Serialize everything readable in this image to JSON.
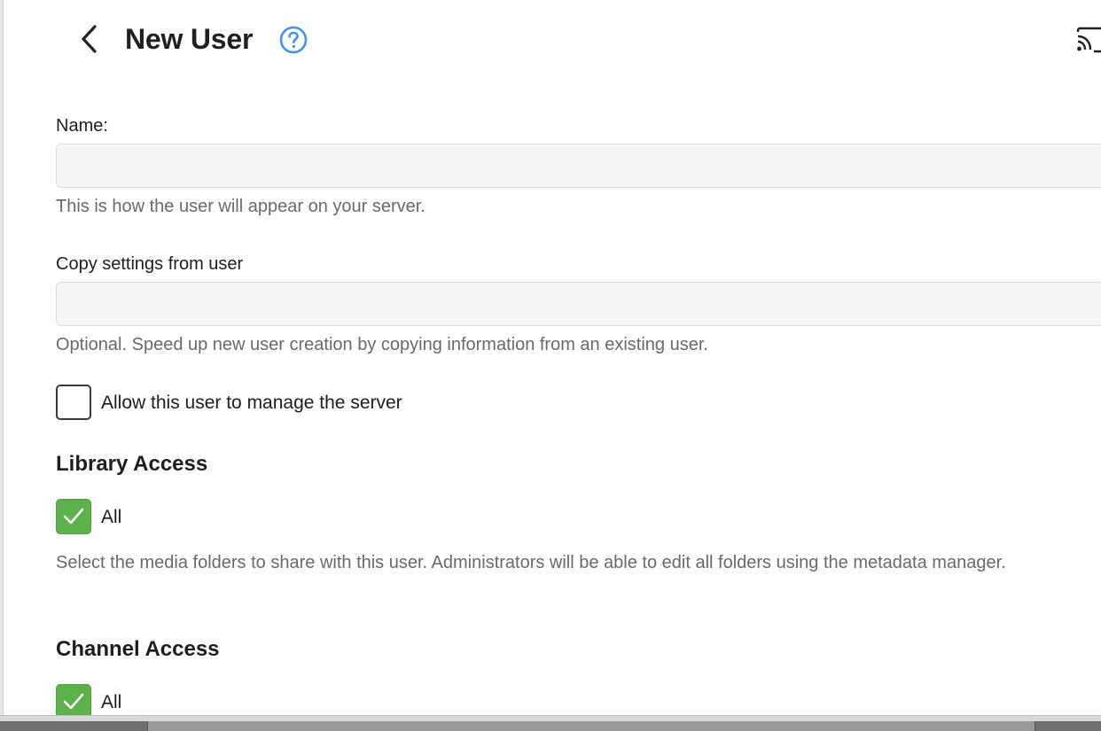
{
  "header": {
    "title": "New User",
    "back_icon": "chevron-left-icon",
    "help_icon": "help-circle-icon",
    "cast_icon": "cast-icon"
  },
  "form": {
    "name": {
      "label": "Name:",
      "value": "",
      "placeholder": "",
      "description": "This is how the user will appear on your server."
    },
    "copy_settings": {
      "label": "Copy settings from user",
      "value": "",
      "placeholder": "",
      "description": "Optional. Speed up new user creation by copying information from an existing user."
    },
    "manage_server": {
      "label": "Allow this user to manage the server",
      "checked": false
    }
  },
  "library_access": {
    "heading": "Library Access",
    "all_label": "All",
    "all_checked": true,
    "description": "Select the media folders to share with this user. Administrators will be able to edit all folders using the metadata manager."
  },
  "channel_access": {
    "heading": "Channel Access",
    "all_label": "All",
    "all_checked": true
  },
  "colors": {
    "accent_check": "#5cb14d",
    "help_icon": "#4a90e2"
  }
}
